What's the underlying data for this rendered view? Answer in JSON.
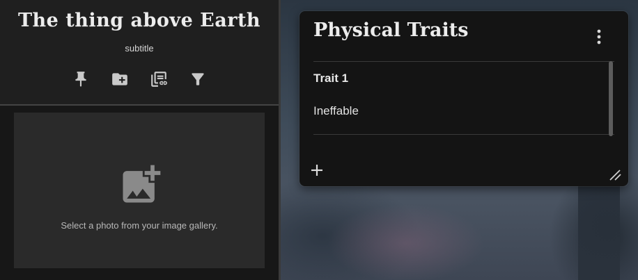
{
  "sidebar": {
    "title": "The thing above Earth",
    "subtitle": "subtitle",
    "toolbar": [
      {
        "icon": "pin-icon"
      },
      {
        "icon": "folder-add-icon"
      },
      {
        "icon": "library-link-icon"
      },
      {
        "icon": "filter-icon"
      }
    ],
    "gallery": {
      "icon": "add-photo-icon",
      "prompt": "Select a photo from your image gallery."
    }
  },
  "card": {
    "title": "Physical Traits",
    "menu_icon": "more-vertical-icon",
    "items": [
      {
        "label": "Trait 1",
        "value": "Ineffable"
      }
    ],
    "add_icon": "plus-icon",
    "resize_icon": "resize-handle-icon"
  },
  "colors": {
    "panel_bg": "#171717",
    "header_bg": "#1f1f1f",
    "card_bg": "#141414",
    "text": "#e6e6e6",
    "icon": "#c9c9c9"
  }
}
